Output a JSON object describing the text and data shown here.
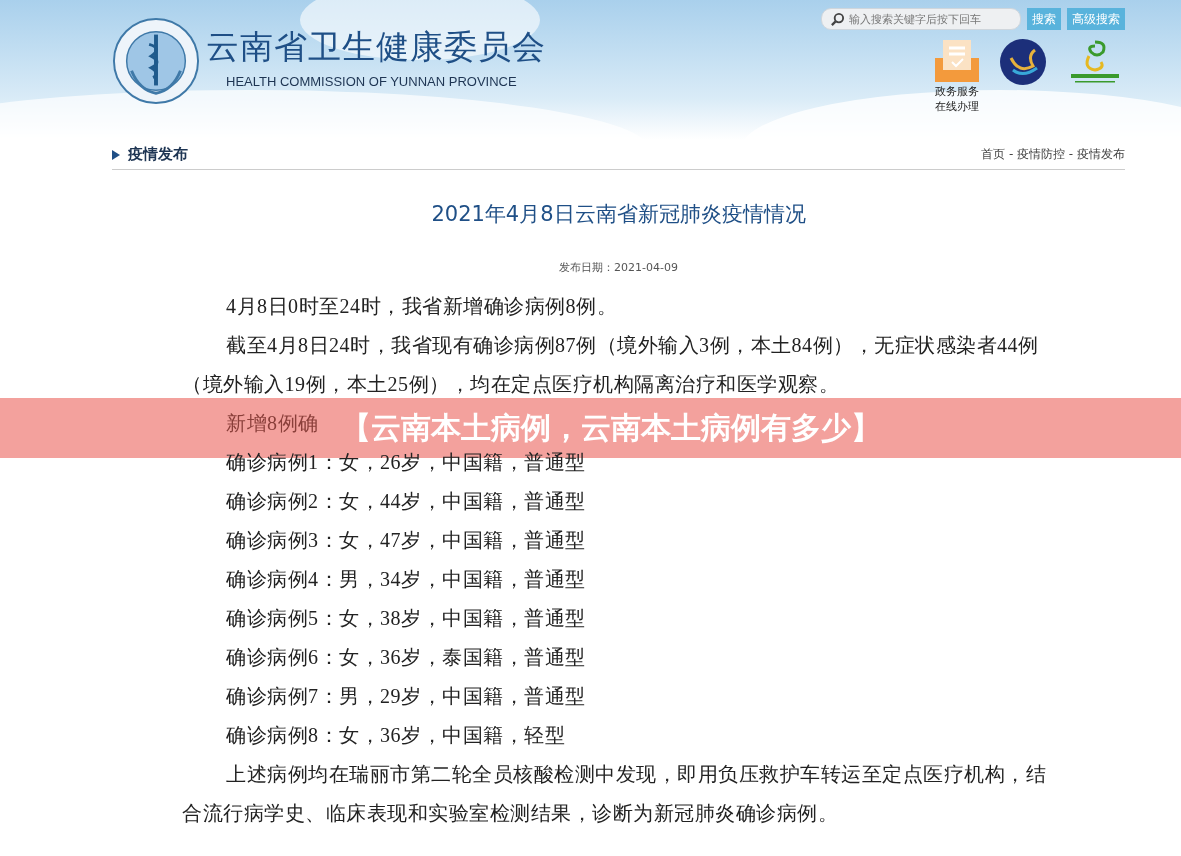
{
  "header": {
    "title": "云南省卫生健康委员会",
    "subtitle": "HEALTH COMMISSION OF YUNNAN PROVINCE",
    "search": {
      "placeholder": "输入搜索关键字后按下回车"
    },
    "buttons": [
      "搜索",
      "高级搜索"
    ],
    "service_link": [
      "政务服务",
      "在线办理"
    ]
  },
  "section": {
    "title": "疫情发布",
    "breadcrumb": [
      "首页",
      "疫情防控",
      "疫情发布"
    ],
    "separator": " - "
  },
  "article": {
    "title": "2021年4月8日云南省新冠肺炎疫情情况",
    "date": "发布日期：2021-04-09",
    "paragraphs": [
      {
        "kind": "indent",
        "text": "4月8日0时至24时，我省新增确诊病例8例。"
      },
      {
        "kind": "indent",
        "text": "截至4月8日24时，我省现有确诊病例87例（境外输入3例，本土84例），无症状感染者44例（境外输入19例，本土25例），均在定点医疗机构隔离治疗和医学观察。"
      },
      {
        "kind": "indent",
        "text": "新增8例确"
      },
      {
        "kind": "indent",
        "text": "确诊病例1：女，26岁，中国籍，普通型"
      },
      {
        "kind": "indent",
        "text": "确诊病例2：女，44岁，中国籍，普通型"
      },
      {
        "kind": "indent",
        "text": "确诊病例3：女，47岁，中国籍，普通型"
      },
      {
        "kind": "indent",
        "text": "确诊病例4：男，34岁，中国籍，普通型"
      },
      {
        "kind": "indent",
        "text": "确诊病例5：女，38岁，中国籍，普通型"
      },
      {
        "kind": "indent",
        "text": "确诊病例6：女，36岁，泰国籍，普通型"
      },
      {
        "kind": "indent",
        "text": "确诊病例7：男，29岁，中国籍，普通型"
      },
      {
        "kind": "indent",
        "text": "确诊病例8：女，36岁，中国籍，轻型"
      },
      {
        "kind": "indent",
        "text": "上述病例均在瑞丽市第二轮全员核酸检测中发现，即用负压救护车转运至定点医疗机构，结合流行病学史、临床表现和实验室检测结果，诊断为新冠肺炎确诊病例。"
      }
    ]
  },
  "banner": {
    "text": "【云南本土病例，云南本土病例有多少】"
  }
}
